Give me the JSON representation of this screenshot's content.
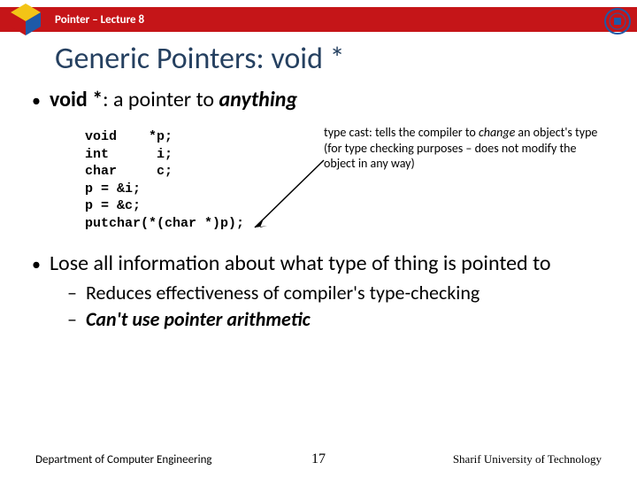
{
  "header": {
    "lecture_label": "Pointer – Lecture 8"
  },
  "title": "Generic Pointers: void *",
  "bullet_main_1": {
    "b1_strong": "void *",
    "b1_mid": ": a pointer to ",
    "b1_em": "anything"
  },
  "code": "void    *p;\nint      i;\nchar     c;\np = &i;\np = &c;\nputchar(*(char *)p);",
  "annotation": {
    "a_pre": "type cast: tells the compiler to ",
    "a_em": "change",
    "a_post": " an object's type (for type checking purposes – does not modify the object in any way)"
  },
  "bullet_main_2": "Lose all information about what type of thing is pointed to",
  "sub_items": {
    "s1": "Reduces effectiveness of compiler's type-checking",
    "s2_strong": "Can't use pointer arithmetic"
  },
  "footer": {
    "left": "Department of Computer Engineering",
    "page": "17",
    "right": "Sharif University of Technology"
  }
}
